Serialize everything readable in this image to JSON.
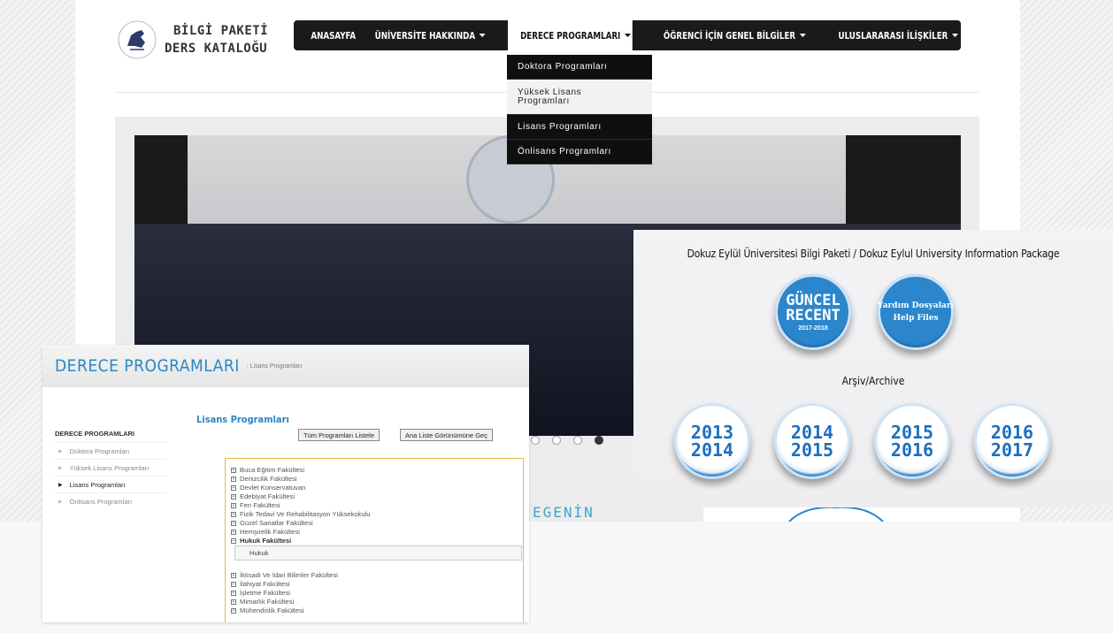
{
  "brand": {
    "line1": "BİLGİ PAKETİ",
    "line2": "DERS KATALOĞU"
  },
  "nav": {
    "items": [
      {
        "label": "ANASAYFA",
        "caret": false
      },
      {
        "label": "ÜNİVERSİTE HAKKINDA",
        "caret": true
      },
      {
        "label": "DERECE PROGRAMLARI",
        "caret": true,
        "active": true
      },
      {
        "label": "ÖĞRENCİ İÇİN GENEL BİLGİLER",
        "caret": true
      },
      {
        "label": "ULUSLARARASI İLİŞKİLER",
        "caret": true
      }
    ],
    "dropdown": [
      "Doktora Programları",
      "Yüksek Lisans Programları",
      "Lisans Programları",
      "Önlisans Programları"
    ]
  },
  "slider": {
    "dots": 4,
    "active_dot": 4,
    "caption_partial": "EGENİN"
  },
  "left_panel": {
    "title": "DERECE PROGRAMLARI",
    "breadcrumb": ": Lisans Programları",
    "sidebar_title": "DERECE PROGRAMLARI",
    "sidebar_items": [
      "Doktora Programları",
      "Yüksek Lisans Programları",
      "Lisans Programları",
      "Önlisans Programları"
    ],
    "sidebar_active": 2,
    "section_title": "Lisans Programları",
    "btn_list": "Tüm Programları Listele",
    "btn_view": "Ana Liste Görünümüne Geç",
    "tree_before": [
      "Buca Eğitim Fakültesi",
      "Denizcilik Fakültesi",
      "Devlet Konservatuvarı",
      "Edebiyat Fakültesi",
      "Fen Fakültesi",
      "Fizik Tedavi Ve Rehabilitasyon Yüksekokulu",
      "Güzel Sanatlar Fakültesi",
      "Hemşirelik Fakültesi"
    ],
    "tree_open": "Hukuk Fakültesi",
    "tree_open_child": "Hukuk",
    "tree_after": [
      "İktisadi Ve İdari Bilimler Fakültesi",
      "İlahiyat Fakültesi",
      "İşletme Fakültesi",
      "Mimarlık Fakültesi",
      "Mühendislik Fakültesi"
    ]
  },
  "right_panel": {
    "title": "Dokuz Eylül Üniversitesi Bilgi Paketi / Dokuz Eylul University Information Package",
    "recent": {
      "l1": "GÜNCEL",
      "l2": "RECENT",
      "l3": "2017-2018"
    },
    "help": {
      "l1": "Yardım Dosyaları",
      "l2": "Help Files"
    },
    "archive_label": "Arşiv/Archive",
    "years": [
      [
        "2013",
        "2014"
      ],
      [
        "2014",
        "2015"
      ],
      [
        "2015",
        "2016"
      ],
      [
        "2016",
        "2017"
      ]
    ]
  },
  "colors": {
    "accent": "#2a86c4",
    "nav_bg": "#1a1a1a",
    "tree_border": "#e2b94a"
  }
}
